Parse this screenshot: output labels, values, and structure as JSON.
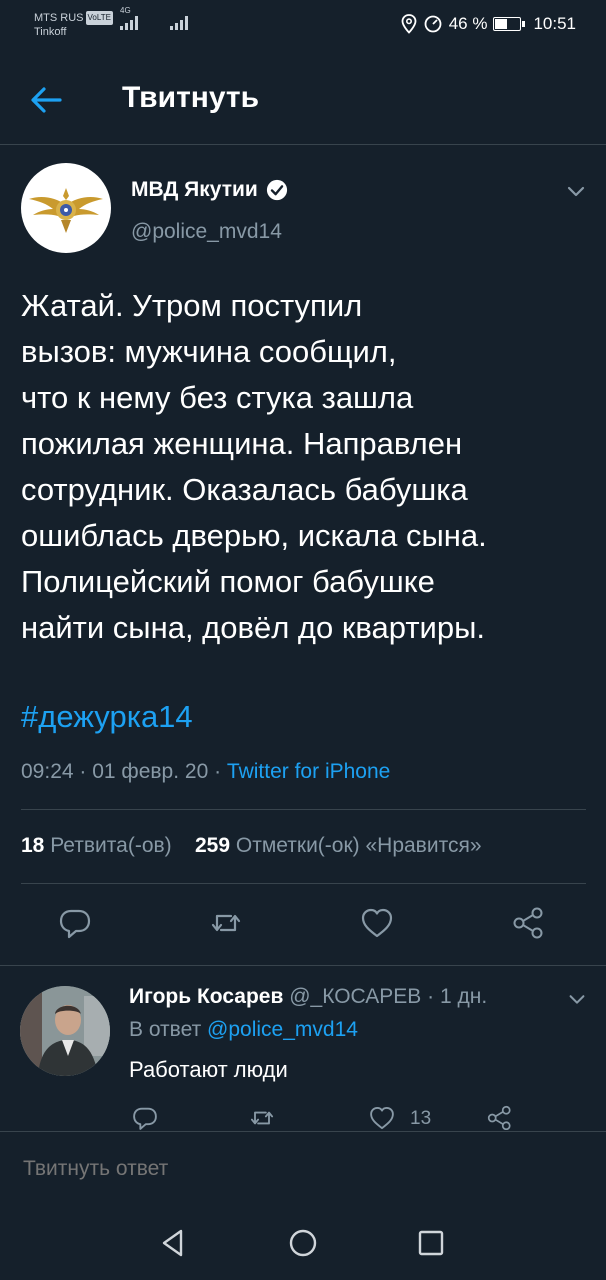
{
  "status_bar": {
    "carrier": "MTS RUS",
    "volte": "VoLTE",
    "carrier2": "Tinkoff",
    "network": "4G",
    "battery_percent": "46 %",
    "battery_level": 0.46,
    "time": "10:51"
  },
  "header": {
    "title": "Твитнуть",
    "back_icon": "arrow-left-icon"
  },
  "tweet": {
    "author_name": "МВД Якутии",
    "handle": "@police_mvd14",
    "verified": true,
    "text": "Жатай. Утром поступил\nвызов: мужчина сообщил,\nчто к нему без стука зашла\nпожилая женщина. Направлен\nсотрудник. Оказалась бабушка\nошиблась дверью, искала сына.\nПолицейский помог бабушке\nнайти сына, довёл до квартиры.",
    "hashtag": "#дежурка14",
    "time": "09:24",
    "date": "01 февр. 20",
    "source": "Twitter for iPhone",
    "retweets_count": "18",
    "retweets_label": "Ретвита(-ов)",
    "likes_count": "259",
    "likes_label": "Отметки(-ок) «Нравится»"
  },
  "reply": {
    "author_name": "Игорь Косарев",
    "handle": "@_КОСАРЕВ",
    "age": "1 дн.",
    "reply_to_prefix": "В ответ",
    "reply_to_handle": "@police_mvd14",
    "text": "Работают люди",
    "like_count": "13"
  },
  "compose": {
    "placeholder": "Твитнуть ответ"
  },
  "colors": {
    "background": "#15202b",
    "accent": "#1da1f2",
    "secondary_text": "#8899a6",
    "divider": "#38444d"
  }
}
